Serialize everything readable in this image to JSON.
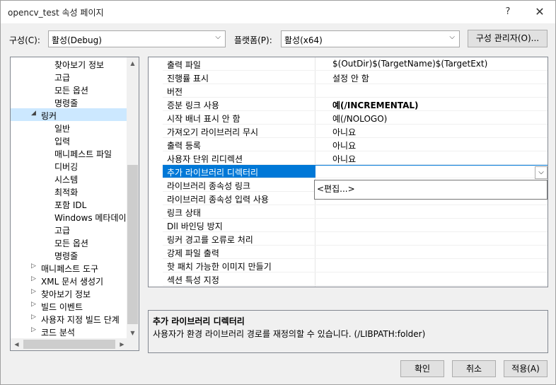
{
  "window": {
    "title": "opencv_test 속성 페이지",
    "help_glyph": "?",
    "close_glyph": "✕"
  },
  "toolbar": {
    "config_label": "구성(C):",
    "config_value": "활성(Debug)",
    "platform_label": "플랫폼(P):",
    "platform_value": "활성(x64)",
    "config_manager_label": "구성 관리자(O)..."
  },
  "tree": {
    "items": [
      {
        "label": "찾아보기 정보",
        "indent": 3,
        "expander": ""
      },
      {
        "label": "고급",
        "indent": 3,
        "expander": ""
      },
      {
        "label": "모든 옵션",
        "indent": 3,
        "expander": ""
      },
      {
        "label": "명령줄",
        "indent": 3,
        "expander": ""
      },
      {
        "label": "링커",
        "indent": 2,
        "expander": "◢",
        "selected": true
      },
      {
        "label": "일반",
        "indent": 3,
        "expander": ""
      },
      {
        "label": "입력",
        "indent": 3,
        "expander": ""
      },
      {
        "label": "매니페스트 파일",
        "indent": 3,
        "expander": ""
      },
      {
        "label": "디버깅",
        "indent": 3,
        "expander": ""
      },
      {
        "label": "시스템",
        "indent": 3,
        "expander": ""
      },
      {
        "label": "최적화",
        "indent": 3,
        "expander": ""
      },
      {
        "label": "포함 IDL",
        "indent": 3,
        "expander": ""
      },
      {
        "label": "Windows 메타데이터",
        "indent": 3,
        "expander": ""
      },
      {
        "label": "고급",
        "indent": 3,
        "expander": ""
      },
      {
        "label": "모든 옵션",
        "indent": 3,
        "expander": ""
      },
      {
        "label": "명령줄",
        "indent": 3,
        "expander": ""
      },
      {
        "label": "매니페스트 도구",
        "indent": 2,
        "expander": "▷"
      },
      {
        "label": "XML 문서 생성기",
        "indent": 2,
        "expander": "▷"
      },
      {
        "label": "찾아보기 정보",
        "indent": 2,
        "expander": "▷"
      },
      {
        "label": "빌드 이벤트",
        "indent": 2,
        "expander": "▷"
      },
      {
        "label": "사용자 지정 빌드 단계",
        "indent": 2,
        "expander": "▷"
      },
      {
        "label": "코드 분석",
        "indent": 2,
        "expander": "▷"
      }
    ]
  },
  "properties": [
    {
      "name": "출력 파일",
      "value": "$(OutDir)$(TargetName)$(TargetExt)",
      "bold": false
    },
    {
      "name": "진행률 표시",
      "value": "설정 안 함",
      "bold": false
    },
    {
      "name": "버전",
      "value": "",
      "bold": false
    },
    {
      "name": "증분 링크 사용",
      "value": "예(/INCREMENTAL)",
      "bold": true
    },
    {
      "name": "시작 배너 표시 안 함",
      "value": "예(/NOLOGO)",
      "bold": false
    },
    {
      "name": "가져오기 라이브러리 무시",
      "value": "아니요",
      "bold": false
    },
    {
      "name": "출력 등록",
      "value": "아니요",
      "bold": false
    },
    {
      "name": "사용자 단위 리디렉션",
      "value": "아니요",
      "bold": false
    },
    {
      "name": "추가 라이브러리 디렉터리",
      "value": "",
      "bold": false,
      "selected": true
    },
    {
      "name": "라이브러리 종속성 링크",
      "value": "",
      "bold": false
    },
    {
      "name": "라이브러리 종속성 입력 사용",
      "value": "",
      "bold": false
    },
    {
      "name": "링크 상태",
      "value": "",
      "bold": false
    },
    {
      "name": "Dll 바인딩 방지",
      "value": "",
      "bold": false
    },
    {
      "name": "링커 경고를 오류로 처리",
      "value": "",
      "bold": false
    },
    {
      "name": "강제 파일 출력",
      "value": "",
      "bold": false
    },
    {
      "name": "핫 패치 가능한 이미지 만들기",
      "value": "",
      "bold": false
    },
    {
      "name": "섹션 특성 지정",
      "value": "",
      "bold": false
    }
  ],
  "dropdown": {
    "item": "<편집...>"
  },
  "description": {
    "title": "추가 라이브러리 디렉터리",
    "text": "사용자가 환경 라이브러리 경로를 재정의할 수 있습니다. (/LIBPATH:folder)"
  },
  "buttons": {
    "ok": "확인",
    "cancel": "취소",
    "apply": "적용(A)"
  }
}
